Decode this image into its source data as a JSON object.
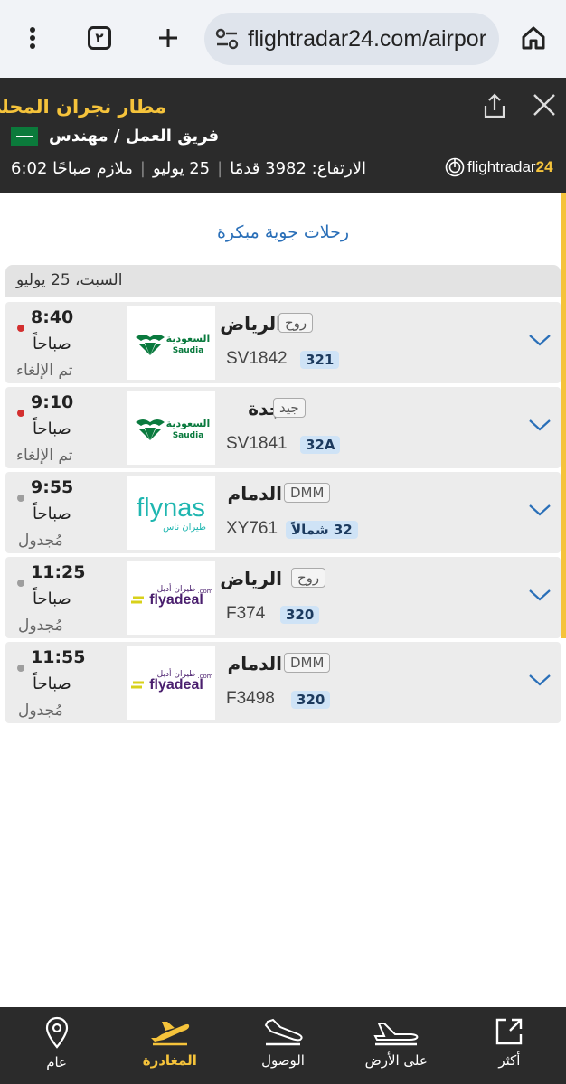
{
  "browser": {
    "tab_count": "٢",
    "url": "flightradar24.com/airpor"
  },
  "header": {
    "airport_name": "مطار نجران المحلي",
    "team": "فريق العمل / مهندس",
    "altitude": "الارتفاع: 3982 قدمًا",
    "date": "25 يوليو",
    "time_label": "ملازم صباحًا 6:02",
    "logo_text": "flightradar",
    "logo_num": "24"
  },
  "early_flights_label": "رحلات جوية مبكرة",
  "date_bar": "السبت، 25 يوليو",
  "flights": [
    {
      "time": "8:40",
      "period": "صباحاً",
      "status": "تم الإلغاء",
      "status_color": "#d32f2f",
      "destination": "الرياض",
      "code": "روح",
      "flight": "SV1842",
      "aircraft": "321",
      "airline": "saudia"
    },
    {
      "time": "9:10",
      "period": "صباحاً",
      "status": "تم الإلغاء",
      "status_color": "#d32f2f",
      "destination": "جدة",
      "code": "جيد",
      "flight": "SV1841",
      "aircraft": "32A",
      "airline": "saudia"
    },
    {
      "time": "9:55",
      "period": "صباحاً",
      "status": "مُجدول",
      "status_color": "#9e9e9e",
      "destination": "الدمام",
      "code": "DMM",
      "flight": "XY761",
      "aircraft": "32 شمالاً",
      "airline": "flynas"
    },
    {
      "time": "11:25",
      "period": "صباحاً",
      "status": "مُجدول",
      "status_color": "#9e9e9e",
      "destination": "الرياض",
      "code": "روح",
      "flight": "F374",
      "aircraft": "320",
      "airline": "flyadeal"
    },
    {
      "time": "11:55",
      "period": "صباحاً",
      "status": "مُجدول",
      "status_color": "#9e9e9e",
      "destination": "الدمام",
      "code": "DMM",
      "flight": "F3498",
      "aircraft": "320",
      "airline": "flyadeal"
    }
  ],
  "airline_logos": {
    "saudia_ar": "السعودية",
    "saudia_en": "Saudia",
    "flynas_en": "flynas",
    "flynas_ar": "طيران ناس",
    "flyadeal_en": "flyadeal",
    "flyadeal_ar": "طيران أديل",
    "flyadeal_com": ".com"
  },
  "nav": {
    "general": "عام",
    "departures": "المغادرة",
    "arrivals": "الوصول",
    "on_ground": "على الأرض",
    "more": "أكثر"
  },
  "colors": {
    "accent": "#f5c33b",
    "header_bg": "#2b2b2b",
    "link": "#2a6fb8"
  }
}
